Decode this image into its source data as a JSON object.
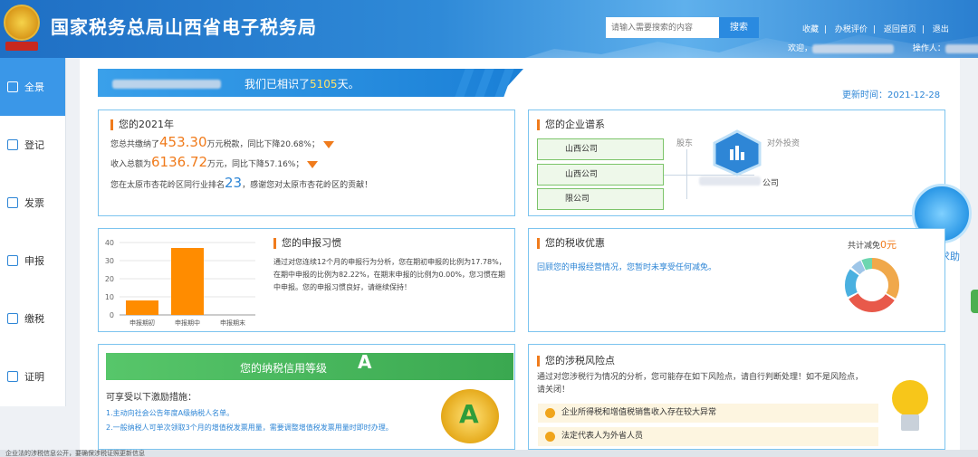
{
  "header": {
    "site_title": "国家税务总局山西省电子税务局",
    "emblem_caption": "中国税务",
    "search_placeholder": "请输入需要搜索的内容",
    "search_button": "搜索",
    "links": [
      "收藏",
      "办税评价",
      "返回首页",
      "退出"
    ],
    "welcome_label": "欢迎，",
    "operator_label": "操作人："
  },
  "sidebar": {
    "items": [
      {
        "label": "全景",
        "active": true
      },
      {
        "label": "登记",
        "active": false
      },
      {
        "label": "发票",
        "active": false
      },
      {
        "label": "申报",
        "active": false
      },
      {
        "label": "缴税",
        "active": false
      },
      {
        "label": "证明",
        "active": false
      }
    ]
  },
  "banner": {
    "prefix": "我们已相识了",
    "days": "5105",
    "suffix": "天。"
  },
  "update_time": "更新时间：2021-12-28",
  "year_panel": {
    "title": "您的2021年",
    "line1_prefix": "您总共缴纳了",
    "line1_amount": "453.30",
    "line1_suffix": "万元税款，同比下降20.68%；",
    "line2_prefix": "收入总额为",
    "line2_amount": "6136.72",
    "line2_suffix": "万元，同比下降57.16%；",
    "line3_prefix": "您在太原市杏花岭区同行业排名",
    "line3_rank": "23",
    "line3_suffix": "，感谢您对太原市杏花岭区的贡献！"
  },
  "enterprise_panel": {
    "title": "您的企业谱系",
    "shareholder_label": "股东",
    "investment_label": "对外投资",
    "entities": [
      "山西公司",
      "山西公司",
      "限公司"
    ],
    "investment_entity": "公司"
  },
  "habit_panel": {
    "title": "您的申报习惯",
    "text": [
      "通过对您连续12个月的申报行为分析，您在期初申报的比例为17.78%，",
      "在期中申报的比例为82.22%，在期末申报的比例为0.00%，您习惯在期",
      "中申报。您的申报习惯良好，请继续保持！"
    ]
  },
  "chart_data": {
    "type": "bar",
    "categories": [
      "申报期初",
      "申报期中",
      "申报期末"
    ],
    "values": [
      8,
      37,
      0
    ],
    "ylim": [
      0,
      40
    ],
    "yticks": [
      0,
      10,
      20,
      30,
      40
    ],
    "color": "#ff8c00"
  },
  "preference_panel": {
    "title": "您的税收优惠",
    "text": "回顾您的申报经营情况，您暂时未享受任何减免。",
    "total_label": "共计减免",
    "total_value": "0元"
  },
  "help": {
    "label": "我要求助"
  },
  "credit_panel": {
    "banner_text": "您的纳税信用等级",
    "grade": "A",
    "heading": "可享受以下激励措施：",
    "items": [
      "1.主动向社会公告年度A级纳税人名单。",
      "2.一般纳税人可单次领取3个月的增值税发票用量，需要调整增值税发票用量时即时办理。"
    ]
  },
  "risk_panel": {
    "title": "您的涉税风险点",
    "intro": [
      "通过对您涉税行为情况的分析，您可能存在如下风险点，请自行判断处理！如不是风险点，",
      "请关闭！"
    ],
    "items": [
      "企业所得税和增值税销售收入存在较大异常",
      "法定代表人为外省人员"
    ]
  },
  "statusbar": {
    "text": "企业法的涉税信息公开，要确保涉税证照更新信息"
  }
}
